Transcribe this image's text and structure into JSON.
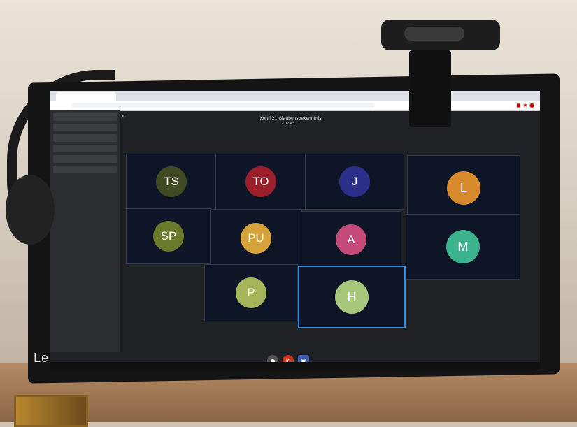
{
  "monitor": {
    "brand": "Lenovo"
  },
  "browser": {
    "tab_title": "",
    "url": ""
  },
  "meeting": {
    "title": "Konfi 21 Glaubensbekenntnis",
    "duration": "2:02:45"
  },
  "chat": {
    "close_label": "✕",
    "input_placeholder": ""
  },
  "participants": [
    {
      "initials": "TS",
      "color": "#3f4a23"
    },
    {
      "initials": "TO",
      "color": "#9a1f2b"
    },
    {
      "initials": "J",
      "color": "#2b2f8a"
    },
    {
      "initials": "L",
      "color": "#d68a2b"
    },
    {
      "initials": "SP",
      "color": "#6b7a2a"
    },
    {
      "initials": "PU",
      "color": "#d6a33a"
    },
    {
      "initials": "A",
      "color": "#c44a7a"
    },
    {
      "initials": "M",
      "color": "#3bb38c"
    },
    {
      "initials": "P",
      "color": "#a6b55a"
    },
    {
      "initials": "H",
      "color": "#a8c77a"
    }
  ],
  "taskbar": {
    "time": ""
  },
  "colors": {
    "screen_bg": "#202124",
    "tile_bg": "#0d1526",
    "active_border": "#2f8fe0"
  }
}
